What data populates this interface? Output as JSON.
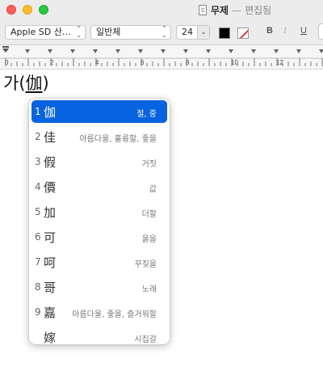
{
  "window": {
    "title": "무제",
    "separator": "—",
    "status": "편집됨"
  },
  "toolbar": {
    "font_family": "Apple SD 산…",
    "font_style": "일반체",
    "font_size": "24",
    "stepper": "⌄",
    "text_color": "#000000",
    "bold_label": "B",
    "italic_label": "I",
    "underline_label": "U",
    "select_arrows": "⌃⌄"
  },
  "ruler": {
    "labels": [
      "0",
      "2",
      "4",
      "6",
      "8",
      "10",
      "12"
    ]
  },
  "document": {
    "text_before": "가(",
    "marked_text": "伽",
    "text_after": ")"
  },
  "candidate_window": {
    "selected_index": 0,
    "accent": "#0863e0",
    "items": [
      {
        "number": "1",
        "hanja": "伽",
        "meaning": "절, 중"
      },
      {
        "number": "2",
        "hanja": "佳",
        "meaning": "아름다울, 훌륭할, 좋을"
      },
      {
        "number": "3",
        "hanja": "假",
        "meaning": "거짓"
      },
      {
        "number": "4",
        "hanja": "價",
        "meaning": "값"
      },
      {
        "number": "5",
        "hanja": "加",
        "meaning": "더할"
      },
      {
        "number": "6",
        "hanja": "可",
        "meaning": "옳을"
      },
      {
        "number": "7",
        "hanja": "呵",
        "meaning": "꾸짖을"
      },
      {
        "number": "8",
        "hanja": "哥",
        "meaning": "노래"
      },
      {
        "number": "9",
        "hanja": "嘉",
        "meaning": "아름다울, 좋을, 즐거워할"
      },
      {
        "number": "",
        "hanja": "嫁",
        "meaning": "시집갈"
      }
    ]
  }
}
